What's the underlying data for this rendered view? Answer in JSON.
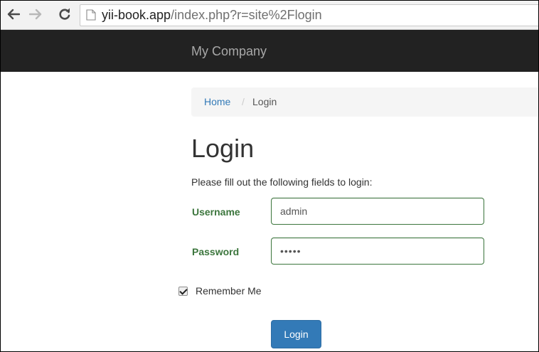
{
  "browser": {
    "url_host": "yii-book.app",
    "url_path": "/index.php?r=site%2Flogin",
    "back_glyph": "🡐",
    "forward_glyph": "🡒",
    "reload_glyph": "↻"
  },
  "navbar": {
    "brand": "My Company",
    "background": "#222222"
  },
  "breadcrumb": {
    "home": "Home",
    "separator": "/",
    "current": "Login"
  },
  "page": {
    "title": "Login",
    "instructions": "Please fill out the following fields to login:"
  },
  "form": {
    "username_label": "Username",
    "username_value": "admin",
    "password_label": "Password",
    "password_value": "•••••",
    "remember_label": "Remember Me",
    "remember_checked": true,
    "submit_label": "Login"
  },
  "colors": {
    "accent": "#337ab7",
    "success": "#3c763d"
  },
  "icons": [
    "back-arrow-icon",
    "forward-arrow-icon",
    "reload-icon",
    "page-icon",
    "checkmark-icon"
  ]
}
